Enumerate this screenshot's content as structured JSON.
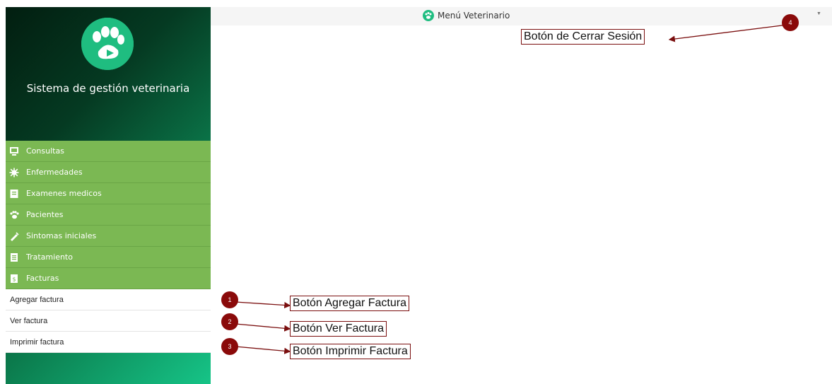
{
  "sidebar": {
    "brand": "Sistema de gestión veterinaria",
    "items": [
      {
        "label": "Consultas",
        "icon": "monitor-icon"
      },
      {
        "label": "Enfermedades",
        "icon": "virus-icon"
      },
      {
        "label": "Examenes medicos",
        "icon": "clipboard-icon"
      },
      {
        "label": "Pacientes",
        "icon": "paw-icon"
      },
      {
        "label": "Sintomas iniciales",
        "icon": "syringe-icon"
      },
      {
        "label": "Tratamiento",
        "icon": "document-icon"
      },
      {
        "label": "Facturas",
        "icon": "invoice-icon"
      }
    ],
    "facturas_sub": [
      {
        "label": "Agregar factura"
      },
      {
        "label": "Ver factura"
      },
      {
        "label": "Imprimir factura"
      }
    ]
  },
  "topbar": {
    "title": "Menú Veterinario",
    "dropdown_icon": "caret-down-icon"
  },
  "annotations": [
    {
      "number": "1",
      "label": "Botón Agregar Factura"
    },
    {
      "number": "2",
      "label": "Botón Ver Factura"
    },
    {
      "number": "3",
      "label": "Botón Imprimir Factura"
    },
    {
      "number": "4",
      "label": "Botón de Cerrar Sesión"
    }
  ],
  "colors": {
    "menu_green": "#7bb853",
    "brand_green": "#1fbd80",
    "annotation_red": "#8a0a0a"
  }
}
